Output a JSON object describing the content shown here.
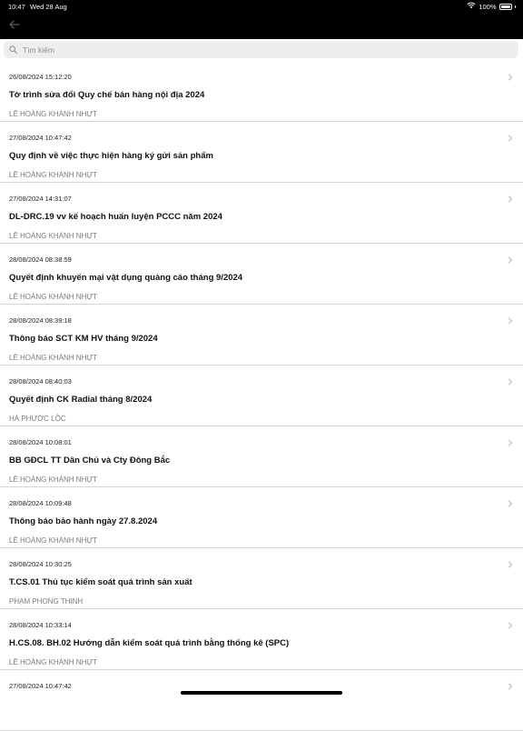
{
  "status_bar": {
    "time": "10:47",
    "date": "Wed 28 Aug",
    "battery": "100%"
  },
  "search": {
    "placeholder": "Tìm kiếm",
    "value": ""
  },
  "items": [
    {
      "timestamp": "26/08/2024 15:12:20",
      "title": "Tờ trình sửa đổi Quy chế bán hàng nội địa 2024",
      "author": "LÊ HOÀNG KHÁNH NHỰT"
    },
    {
      "timestamp": "27/08/2024 10:47:42",
      "title": "Quy định về việc thực hiện hàng ký gửi sản phẩm",
      "author": "LÊ HOÀNG KHÁNH NHỰT"
    },
    {
      "timestamp": "27/08/2024 14:31:07",
      "title": "DL-DRC.19 vv kế hoạch huấn luyện PCCC năm 2024",
      "author": "LÊ HOÀNG KHÁNH NHỰT"
    },
    {
      "timestamp": "28/08/2024 08:38:59",
      "title": "Quyết định khuyến mại vật dụng quảng cáo tháng 9/2024",
      "author": "LÊ HOÀNG KHÁNH NHỰT"
    },
    {
      "timestamp": "28/08/2024 08:39:18",
      "title": "Thông báo SCT KM HV tháng 9/2024",
      "author": "LÊ HOÀNG KHÁNH NHỰT"
    },
    {
      "timestamp": "28/08/2024 08:40:03",
      "title": "Quyết định CK Radial tháng 8/2024",
      "author": "HÀ PHƯỚC LỘC"
    },
    {
      "timestamp": "28/08/2024 10:08:01",
      "title": "BB GĐCL TT Dân Chủ và Cty Đông Bắc",
      "author": "LÊ HOÀNG KHÁNH NHỰT"
    },
    {
      "timestamp": "28/08/2024 10:09:48",
      "title": "Thông báo bảo hành ngày 27.8.2024",
      "author": "LÊ HOÀNG KHÁNH NHỰT"
    },
    {
      "timestamp": "28/08/2024 10:30:25",
      "title": "T.CS.01 Thủ tục kiểm soát quá trình sản xuất",
      "author": "PHẠM PHONG THỊNH"
    },
    {
      "timestamp": "28/08/2024 10:33:14",
      "title": "H.CS.08. BH.02 Hướng dẫn kiểm soát quá trình bằng thống kê (SPC)",
      "author": "LÊ HOÀNG KHÁNH NHỰT"
    },
    {
      "timestamp": "27/08/2024 10:47:42",
      "title": "",
      "author": ""
    }
  ]
}
